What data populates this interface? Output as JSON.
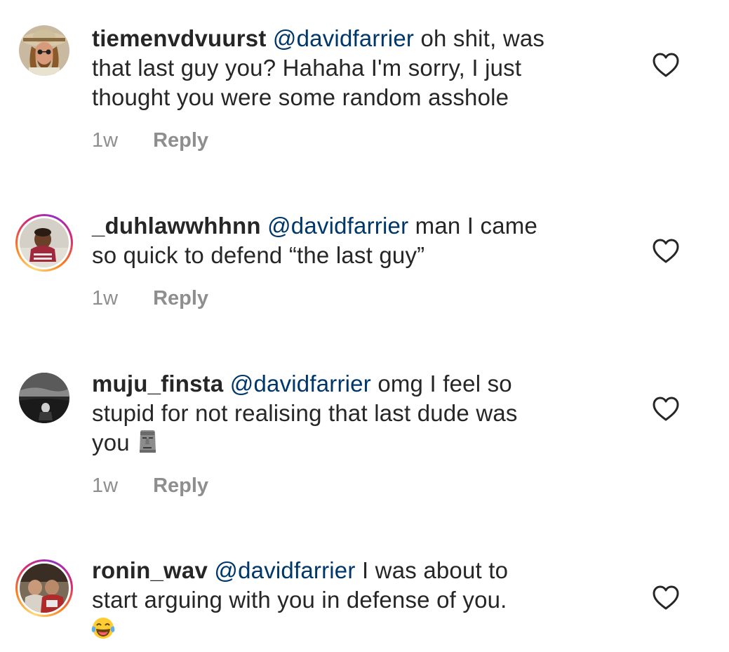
{
  "comments": [
    {
      "username": "tiemenvdvuurst",
      "mention": "@davidfarrier",
      "text_lines": [
        "oh shit, was",
        "that last guy you? Hahaha I'm sorry, I just",
        "thought you were some random asshole"
      ],
      "time": "1w",
      "reply_label": "Reply",
      "has_story_ring": false,
      "emoji": ""
    },
    {
      "username": "_duhlawwhhnn",
      "mention": "@davidfarrier",
      "text_lines": [
        "man I came",
        "so quick to defend “the last guy”"
      ],
      "time": "1w",
      "reply_label": "Reply",
      "has_story_ring": true,
      "emoji": ""
    },
    {
      "username": "muju_finsta",
      "mention": "@davidfarrier",
      "text_lines": [
        "omg I feel so",
        "stupid for not realising that last dude was",
        "you"
      ],
      "time": "1w",
      "reply_label": "Reply",
      "has_story_ring": false,
      "emoji": "moai-emoji"
    },
    {
      "username": "ronin_wav",
      "mention": "@davidfarrier",
      "text_lines": [
        "I was about to",
        "start arguing with you in defense of you."
      ],
      "time": "",
      "reply_label": "",
      "has_story_ring": true,
      "emoji": "tears-of-joy-emoji"
    }
  ],
  "icons": {
    "like": "heart-outline-icon"
  },
  "colors": {
    "mention": "#00376b",
    "text": "#262626",
    "meta": "#8e8e8e"
  }
}
